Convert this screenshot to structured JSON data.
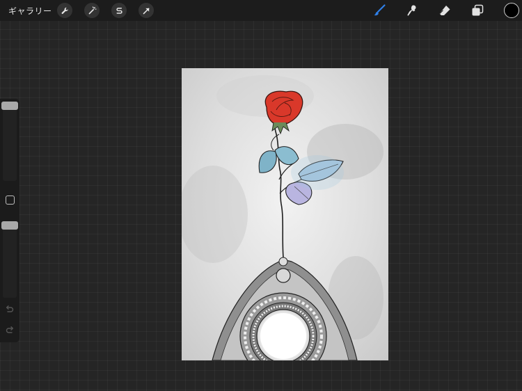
{
  "topbar": {
    "gallery_label": "ギャラリー",
    "actions": [
      {
        "icon": "wrench-icon"
      },
      {
        "icon": "magic-wand-icon"
      },
      {
        "icon": "selection-s-icon"
      },
      {
        "icon": "transform-arrow-icon"
      }
    ],
    "tools": [
      {
        "icon": "brush-icon",
        "active": true
      },
      {
        "icon": "smudge-icon",
        "active": false
      },
      {
        "icon": "eraser-icon",
        "active": false
      },
      {
        "icon": "layers-icon",
        "active": false
      }
    ],
    "current_color": "#000000"
  },
  "sidebar": {
    "brush_size_level": 0.0,
    "opacity_level": 0.0,
    "undo_icon": "undo-icon",
    "redo_icon": "redo-icon"
  },
  "canvas": {
    "artwork": "rose-above-rotor",
    "colors": {
      "rose": "#d9382a",
      "leaves": "#7fb3c8",
      "paper": "#e6e6e6",
      "accent_active": "#2f7fe8"
    }
  }
}
